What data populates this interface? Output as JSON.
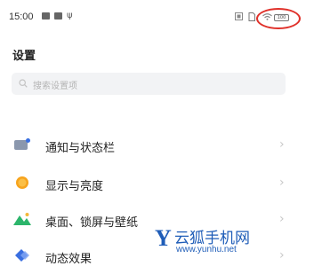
{
  "status_bar": {
    "time": "15:00",
    "usb_symbol": "ψ",
    "battery_text": "100"
  },
  "page": {
    "title": "设置"
  },
  "search": {
    "placeholder": "搜索设置项"
  },
  "settings_items": [
    {
      "label": "通知与状态栏",
      "icon": "notification-icon",
      "color": "#7f8fa6"
    },
    {
      "label": "显示与亮度",
      "icon": "brightness-icon",
      "color": "#f7a41d"
    },
    {
      "label": "桌面、锁屏与壁纸",
      "icon": "wallpaper-icon",
      "color": "#2cb56b"
    },
    {
      "label": "动态效果",
      "icon": "animation-icon",
      "color": "#3a6fe0"
    }
  ],
  "watermark": {
    "logo": "Y",
    "name": "云狐手机网",
    "url": "www.yunhu.net"
  }
}
